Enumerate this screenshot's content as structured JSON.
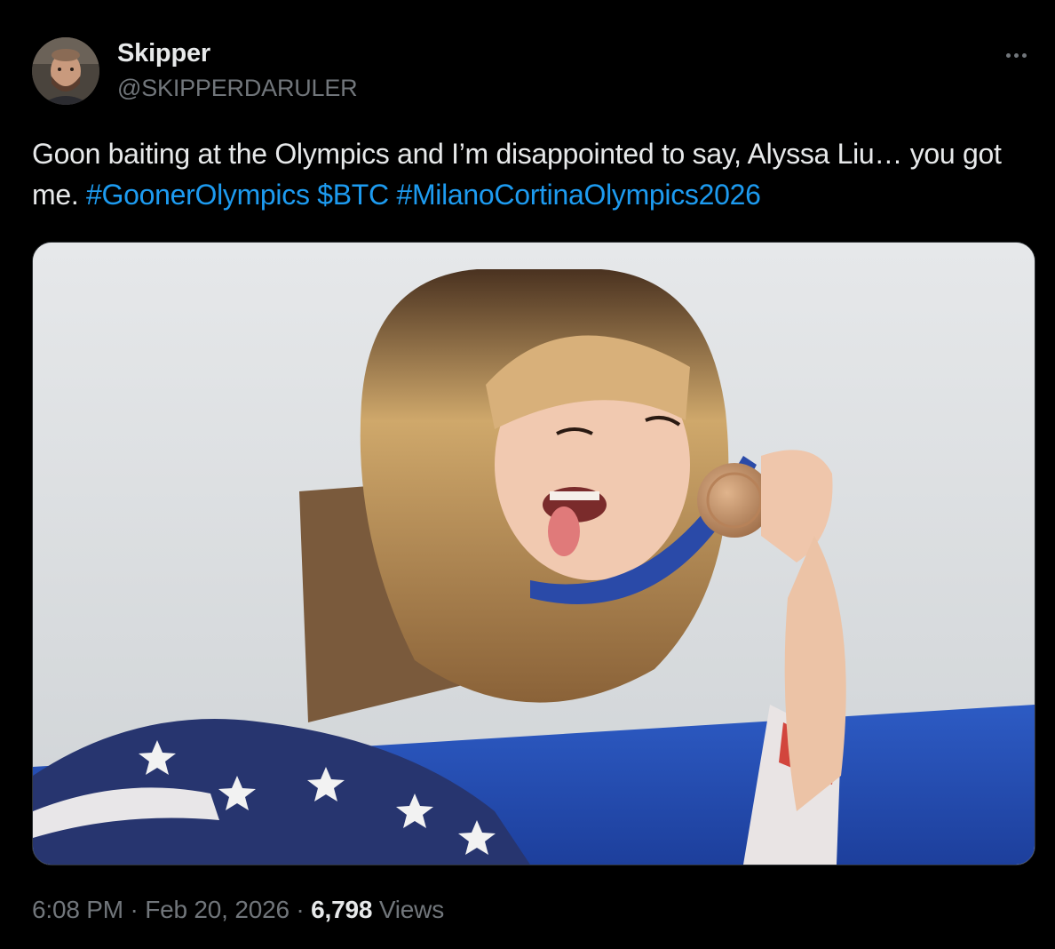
{
  "author": {
    "display_name": "Skipper",
    "handle": "@SKIPPERDARULER",
    "avatar_icon": "user-avatar"
  },
  "more_icon": "more-horizontal-icon",
  "tweet": {
    "text_plain": "Goon baiting at the Olympics and I’m disappointed to say, Alyssa Liu… you got me.",
    "hashtags": [
      "#GoonerOlympics",
      "$BTC",
      "#MilanoCortinaOlympics2026"
    ]
  },
  "meta": {
    "time": "6:08 PM",
    "separator": "·",
    "date": "Feb 20, 2026",
    "views_count": "6,798",
    "views_label": "Views"
  },
  "colors": {
    "background": "#000000",
    "text": "#e7e9ea",
    "secondary_text": "#71767b",
    "link": "#1d9bf0",
    "border": "#2f3336"
  }
}
